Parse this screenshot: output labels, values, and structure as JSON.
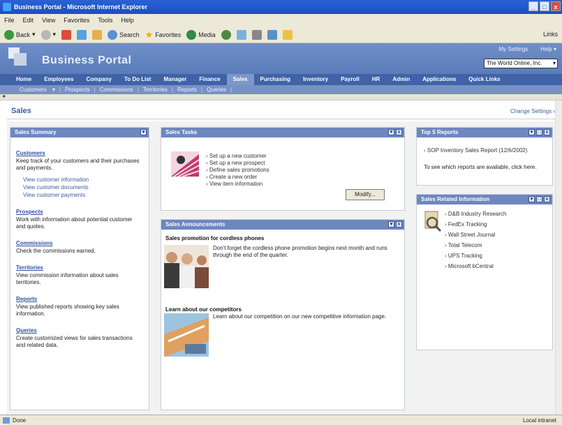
{
  "window": {
    "title": "Business Portal - Microsoft Internet Explorer",
    "min": "_",
    "max": "□",
    "close": "x"
  },
  "menu": [
    "File",
    "Edit",
    "View",
    "Favorites",
    "Tools",
    "Help"
  ],
  "toolbar": {
    "back": "Back",
    "search": "Search",
    "favorites": "Favorites",
    "media": "Media",
    "links": "Links"
  },
  "header": {
    "title": "Business Portal",
    "my_settings": "My Settings",
    "help": "Help",
    "org": "The World Online, Inc."
  },
  "main_nav": [
    "Home",
    "Employees",
    "Company",
    "To Do List",
    "Manager",
    "Finance",
    "Sales",
    "Purchasing",
    "Inventory",
    "Payroll",
    "HR",
    "Admin",
    "Applications",
    "Quick Links"
  ],
  "active_nav": "Sales",
  "sub_nav": [
    "Customers",
    "Prospects",
    "Commissions",
    "Territories",
    "Reports",
    "Queries"
  ],
  "page": {
    "title": "Sales",
    "change_settings": "Change Settings"
  },
  "summary": {
    "title": "Sales Summary",
    "sections": [
      {
        "title": "Customers",
        "desc": "Keep track of your customers and their purchases and payments.",
        "links": [
          "View customer information",
          "View customer documents",
          "View customer payments"
        ]
      },
      {
        "title": "Prospects",
        "desc": "Work with information about potential customer and quotes."
      },
      {
        "title": "Commissions",
        "desc": "Check the commissions earned."
      },
      {
        "title": "Territories",
        "desc": "View commission information about sales territories."
      },
      {
        "title": "Reports",
        "desc": "View published reports showing key sales information."
      },
      {
        "title": "Queries",
        "desc": "Create customized views for sales transactions and related data."
      }
    ]
  },
  "tasks": {
    "title": "Sales Tasks",
    "items": [
      "Set up a new customer",
      "Set up a new prospect",
      "Define sales promotions",
      "Create a new order",
      "View item information"
    ],
    "modify": "Modify..."
  },
  "announcements": {
    "title": "Sales Announcements",
    "items": [
      {
        "title": "Sales promotion for cordless phones",
        "body": "Don't forget the cordless phone promotion begins next month and runs through the end of the quarter."
      },
      {
        "title": "Learn about our competitors",
        "body": "Learn about our competition on our new competitive information page."
      }
    ]
  },
  "top_reports": {
    "title": "Top 5 Reports",
    "item": "SOP Inventory Sales Report (12/6/2002)",
    "note": "To see which reports are available, click here."
  },
  "related": {
    "title": "Sales Related Information",
    "items": [
      "D&B Industry Research",
      "FedEx Tracking",
      "Wall Street Journal",
      "Total Telecom",
      "UPS Tracking",
      "Microsoft bCentral"
    ]
  },
  "status": {
    "left": "Done",
    "zone": "Local intranet"
  }
}
